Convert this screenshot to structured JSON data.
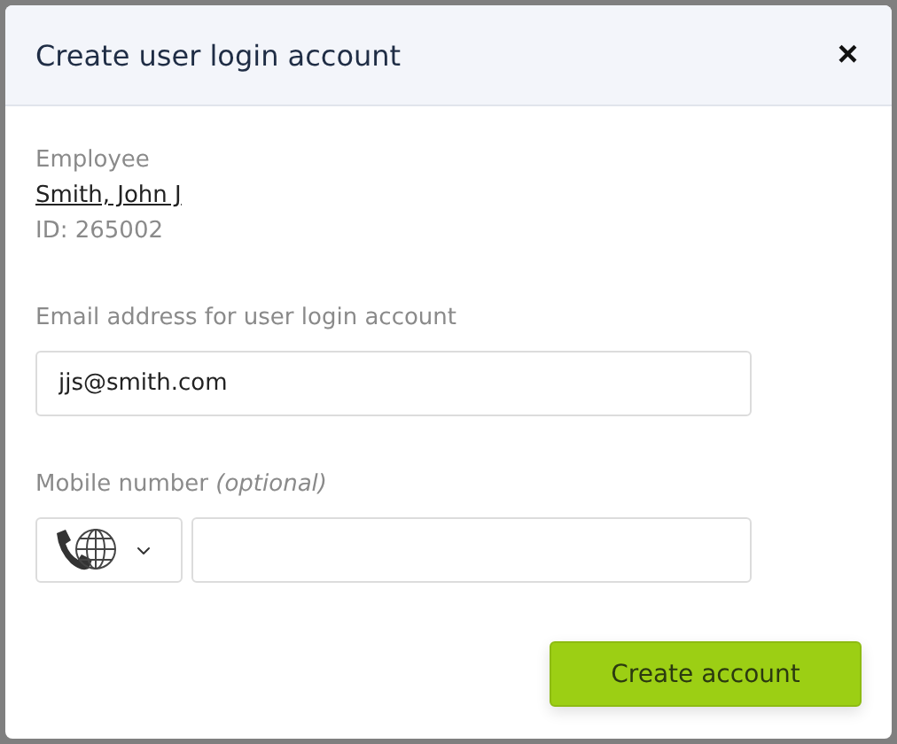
{
  "dialog": {
    "title": "Create user login account",
    "close": "×"
  },
  "employee": {
    "label": "Employee",
    "name": "Smith, John J",
    "id": "ID: 265002"
  },
  "email": {
    "label": "Email address for user login account",
    "value": "jjs@smith.com"
  },
  "mobile": {
    "label": "Mobile number *(optional)*"
  },
  "submit": "Create account"
}
